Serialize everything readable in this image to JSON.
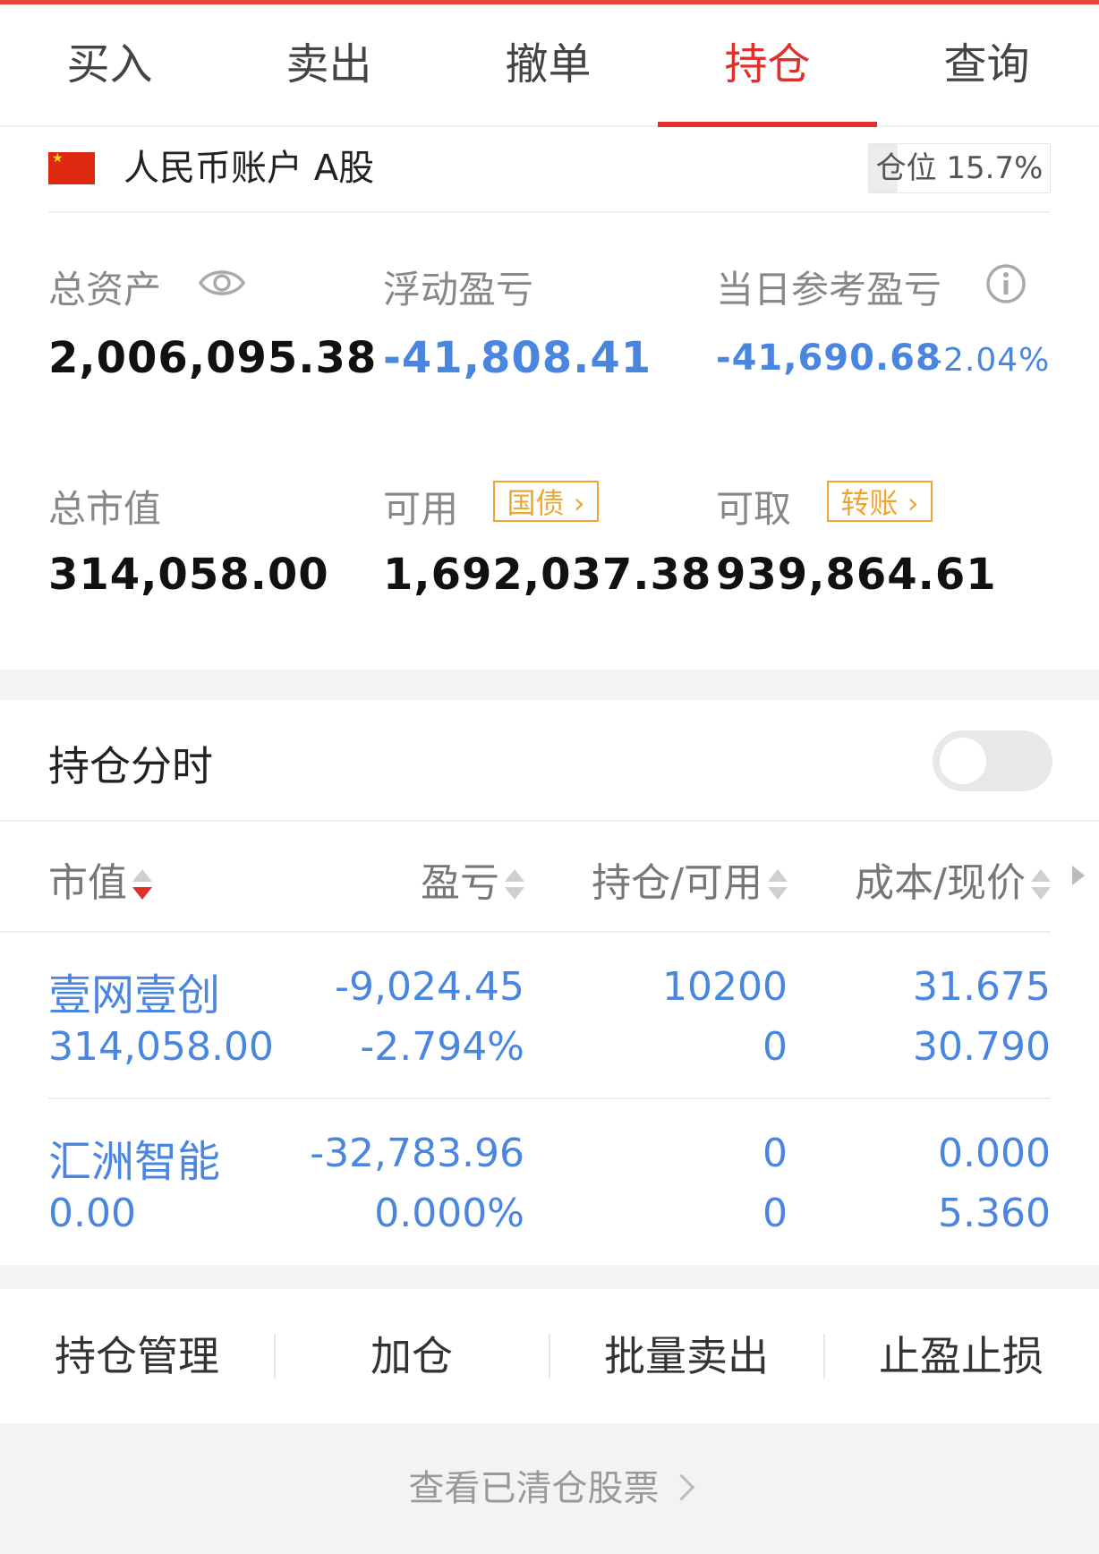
{
  "tabs": [
    {
      "label": "买入",
      "active": false
    },
    {
      "label": "卖出",
      "active": false
    },
    {
      "label": "撤单",
      "active": false
    },
    {
      "label": "持仓",
      "active": true
    },
    {
      "label": "查询",
      "active": false
    }
  ],
  "account": {
    "name": "人民币账户 A股",
    "position_label": "仓位 15.7%",
    "position_ratio": 0.157
  },
  "stats": {
    "total_assets_label": "总资产",
    "total_assets": "2,006,095.38",
    "float_pl_label": "浮动盈亏",
    "float_pl": "-41,808.41",
    "day_pl_label": "当日参考盈亏",
    "day_pl": "-41,690.68",
    "day_pl_pct": "-2.04%",
    "market_value_label": "总市值",
    "market_value": "314,058.00",
    "available_label": "可用",
    "available_tag": "国债",
    "available": "1,692,037.38",
    "withdrawable_label": "可取",
    "withdrawable_tag": "转账",
    "withdrawable": "939,864.61"
  },
  "toggle_row": {
    "label": "持仓分时",
    "enabled": false
  },
  "table": {
    "headers": [
      "市值",
      "盈亏",
      "持仓/可用",
      "成本/现价"
    ],
    "rows": [
      {
        "name": "壹网壹创",
        "market_value": "314,058.00",
        "pl": "-9,024.45",
        "pl_pct": "-2.794%",
        "position": "10200",
        "available": "0",
        "cost": "31.675",
        "price": "30.790"
      },
      {
        "name": "汇洲智能",
        "market_value": "0.00",
        "pl": "-32,783.96",
        "pl_pct": "0.000%",
        "position": "0",
        "available": "0",
        "cost": "0.000",
        "price": "5.360"
      }
    ]
  },
  "actions": [
    "持仓管理",
    "加仓",
    "批量卖出",
    "止盈止损"
  ],
  "footer_link": "查看已清仓股票",
  "colors": {
    "accent_red": "#e0302b",
    "loss_blue": "#4a86e0",
    "tag_orange": "#f0a531"
  }
}
